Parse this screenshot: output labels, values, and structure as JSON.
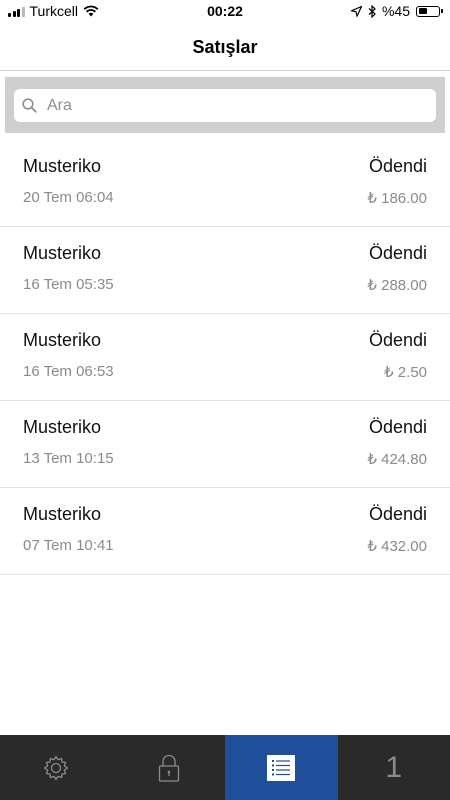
{
  "status_bar": {
    "carrier": "Turkcell",
    "time": "00:22",
    "battery_label": "%45",
    "battery_level": 0.45,
    "icons": [
      "signal-icon",
      "wifi-icon",
      "location-icon",
      "bluetooth-icon",
      "battery-icon"
    ]
  },
  "header": {
    "title": "Satışlar"
  },
  "search": {
    "placeholder": "Ara",
    "value": ""
  },
  "sales": [
    {
      "name": "Musteriko",
      "status": "Ödendi",
      "date": "20 Tem 06:04",
      "amount": "₺ 186.00"
    },
    {
      "name": "Musteriko",
      "status": "Ödendi",
      "date": "16 Tem 05:35",
      "amount": "₺ 288.00"
    },
    {
      "name": "Musteriko",
      "status": "Ödendi",
      "date": "16 Tem 06:53",
      "amount": "₺ 2.50"
    },
    {
      "name": "Musteriko",
      "status": "Ödendi",
      "date": "13 Tem 10:15",
      "amount": "₺ 424.80"
    },
    {
      "name": "Musteriko",
      "status": "Ödendi",
      "date": "07 Tem 10:41",
      "amount": "₺ 432.00"
    }
  ],
  "tabbar": {
    "tabs": [
      {
        "icon": "gear-icon",
        "active": false
      },
      {
        "icon": "lock-icon",
        "active": false
      },
      {
        "icon": "list-icon",
        "active": true
      },
      {
        "label": "1",
        "active": false
      }
    ],
    "active_color": "#1f4f9a",
    "background": "#2a2a2a"
  }
}
